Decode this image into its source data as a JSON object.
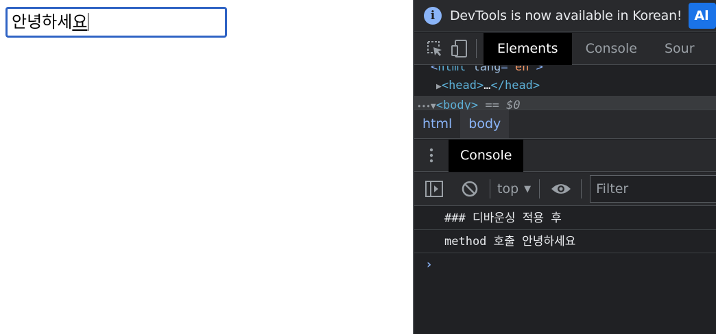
{
  "page": {
    "input": {
      "value_prefix": "안녕하세",
      "value_composing": "요"
    }
  },
  "devtools": {
    "infobar": {
      "message": "DevTools is now available in Korean!",
      "button_label": "Al",
      "icon": "info-icon"
    },
    "main_tabs": [
      {
        "label": "Elements",
        "active": true
      },
      {
        "label": "Console",
        "active": false
      },
      {
        "label": "Sour",
        "active": false
      }
    ],
    "elements_tree": {
      "html_line": {
        "open": "<",
        "tag": "html",
        "attr": "lang",
        "eq": "=",
        "value": "\"en\"",
        "close": ">"
      },
      "head_line": {
        "arrow": "▶",
        "open": "<head>",
        "ellipsis": "…",
        "close": "</head>"
      },
      "body_line": {
        "dots": "•••",
        "arrow": "▼",
        "open": "<body>",
        "marker": "== $0"
      }
    },
    "breadcrumbs": [
      "html",
      "body"
    ],
    "drawer": {
      "tab_label": "Console"
    },
    "console_toolbar": {
      "context": "top",
      "filter_placeholder": "Filter"
    },
    "console_messages": [
      {
        "text": "### 디바운싱 적용 후"
      },
      {
        "text": "method 호출 안녕하세요"
      }
    ],
    "prompt_symbol": "›",
    "colors": {
      "accent": "#8ab4f8",
      "button": "#1a73e8",
      "background": "#202124",
      "input_border": "#2f63c4"
    }
  }
}
